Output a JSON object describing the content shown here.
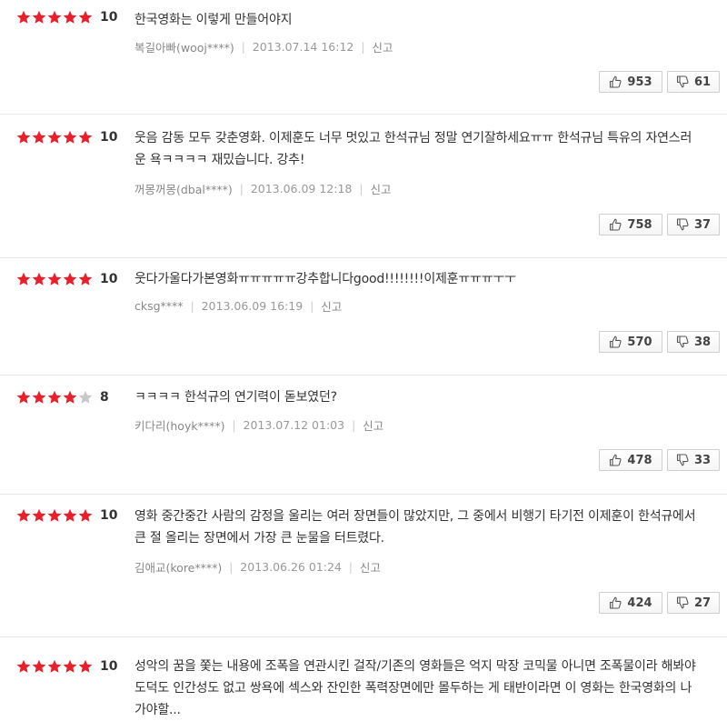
{
  "colors": {
    "star_on": "#e8202b",
    "star_off": "#c8c8c8"
  },
  "reviews": [
    {
      "stars": 5,
      "score": "10",
      "text": "한국영화는 이렇게 만들어야지",
      "author": "복길아빠(wooj****)",
      "date": "2013.07.14 16:12",
      "report": "신고",
      "up": "953",
      "down": "61"
    },
    {
      "stars": 5,
      "score": "10",
      "text": "웃음 감동 모두 갖춘영화. 이제훈도 너무 멋있고 한석규님 정말 연기잘하세요ㅠㅠ 한석규님 특유의 자연스러운 욕ㅋㅋㅋㅋ 재밌습니다. 강추!",
      "author": "꺼몽꺼몽(dbal****)",
      "date": "2013.06.09 12:18",
      "report": "신고",
      "up": "758",
      "down": "37"
    },
    {
      "stars": 5,
      "score": "10",
      "text": "웃다가울다가본영화ㅠㅠㅠㅠㅠ강추합니다good!!!!!!!!이제훈ㅠㅠㅠㅜㅜ",
      "author": "cksg****",
      "date": "2013.06.09 16:19",
      "report": "신고",
      "up": "570",
      "down": "38"
    },
    {
      "stars": 4,
      "score": "8",
      "text": "ㅋㅋㅋㅋ 한석규의 연기력이 돋보였던?",
      "author": "키다리(hoyk****)",
      "date": "2013.07.12 01:03",
      "report": "신고",
      "up": "478",
      "down": "33"
    },
    {
      "stars": 5,
      "score": "10",
      "text": "영화 중간중간 사람의 감정을 울리는 여러 장면들이 많았지만, 그 중에서 비행기 타기전 이제훈이 한석규에서 큰 절 올리는 장면에서 가장 큰 눈물을 터트렸다.",
      "author": "김애교(kore****)",
      "date": "2013.06.26 01:24",
      "report": "신고",
      "up": "424",
      "down": "27"
    },
    {
      "stars": 5,
      "score": "10",
      "text": "성악의 꿈을 쫓는 내용에 조폭을 연관시킨 걸작/기존의 영화들은 억지 막장 코믹물 아니면 조폭물이라 해봐야 도덕도 인간성도 없고 쌍욕에 섹스와 잔인한 폭력장면에만 몰두하는 게 태반이라면 이 영화는 한국영화의 나가야할..."
    }
  ]
}
